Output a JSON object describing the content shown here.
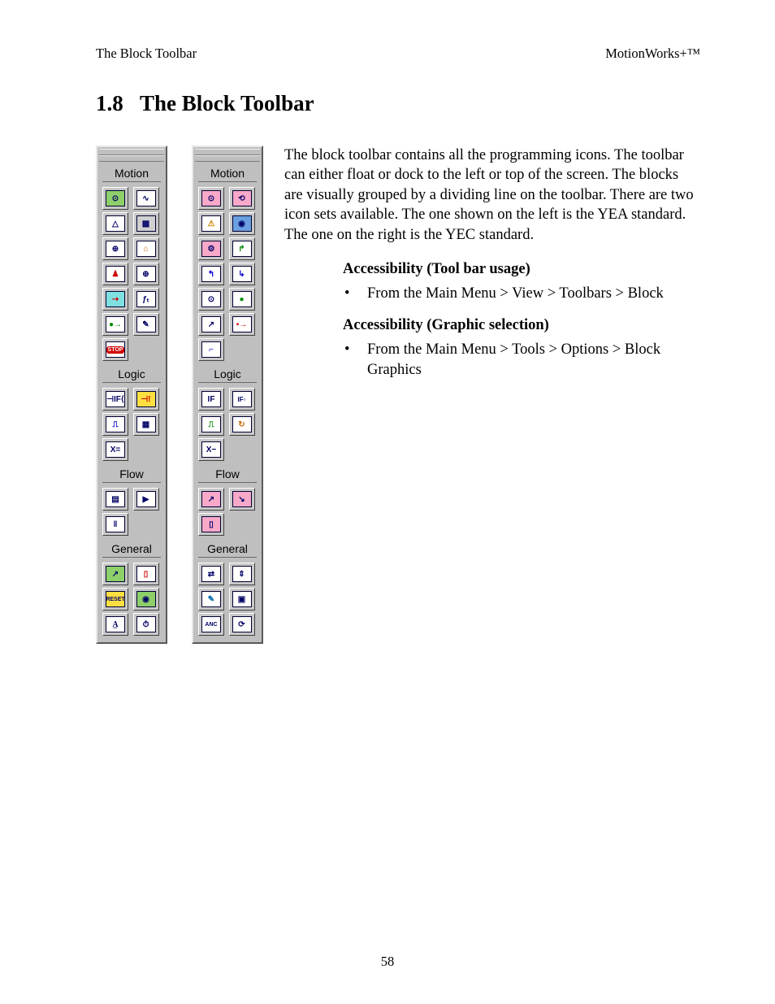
{
  "header": {
    "left": "The Block Toolbar",
    "right": "MotionWorks+™"
  },
  "section_number": "1.8",
  "section_title": "The Block Toolbar",
  "paragraph": "The block toolbar contains all the programming icons.  The tool­bar can either float or dock to the left or top of the screen. The blocks are visually grouped by a dividing line on the toolbar. There are two icon sets available.  The one shown on the left is the YEA standard.  The one on the right is the YEC standard.",
  "sub1_title": "Accessibility (Tool bar usage)",
  "sub1_bullet": "From the Main Menu > View > Toolbars > Block",
  "sub2_title": "Accessibility (Graphic selection)",
  "sub2_bullet": "From the Main Menu > Tools > Options > Block Graphics",
  "page_number": "58",
  "toolbars": {
    "left": {
      "sections": [
        {
          "label": "Motion",
          "icons": [
            "motion-1",
            "motion-2",
            "motion-3",
            "motion-4",
            "motion-5",
            "motion-6",
            "motion-7",
            "motion-8",
            "motion-9",
            "motion-10",
            "motion-11",
            "motion-12",
            "motion-stop"
          ]
        },
        {
          "label": "Logic",
          "icons": [
            "logic-if",
            "logic-wait",
            "logic-input",
            "logic-output",
            "logic-xeq"
          ]
        },
        {
          "label": "Flow",
          "icons": [
            "flow-sub",
            "flow-run",
            "flow-end"
          ]
        },
        {
          "label": "General",
          "icons": [
            "gen-1",
            "gen-2",
            "gen-3",
            "gen-4",
            "gen-text",
            "gen-timer"
          ]
        }
      ]
    },
    "right": {
      "sections": [
        {
          "label": "Motion",
          "icons": [
            "rm-1",
            "rm-2",
            "rm-3",
            "rm-4",
            "rm-5",
            "rm-6",
            "rm-7",
            "rm-8",
            "rm-9",
            "rm-10",
            "rm-11",
            "rm-12",
            "rm-13"
          ]
        },
        {
          "label": "Logic",
          "icons": [
            "rl-if",
            "rl-ifbit",
            "rl-set",
            "rl-loop",
            "rl-xminus"
          ]
        },
        {
          "label": "Flow",
          "icons": [
            "rf-1",
            "rf-2",
            "rf-3"
          ]
        },
        {
          "label": "General",
          "icons": [
            "rg-1",
            "rg-2",
            "rg-3",
            "rg-4",
            "rg-anc",
            "rg-6"
          ]
        }
      ]
    }
  }
}
